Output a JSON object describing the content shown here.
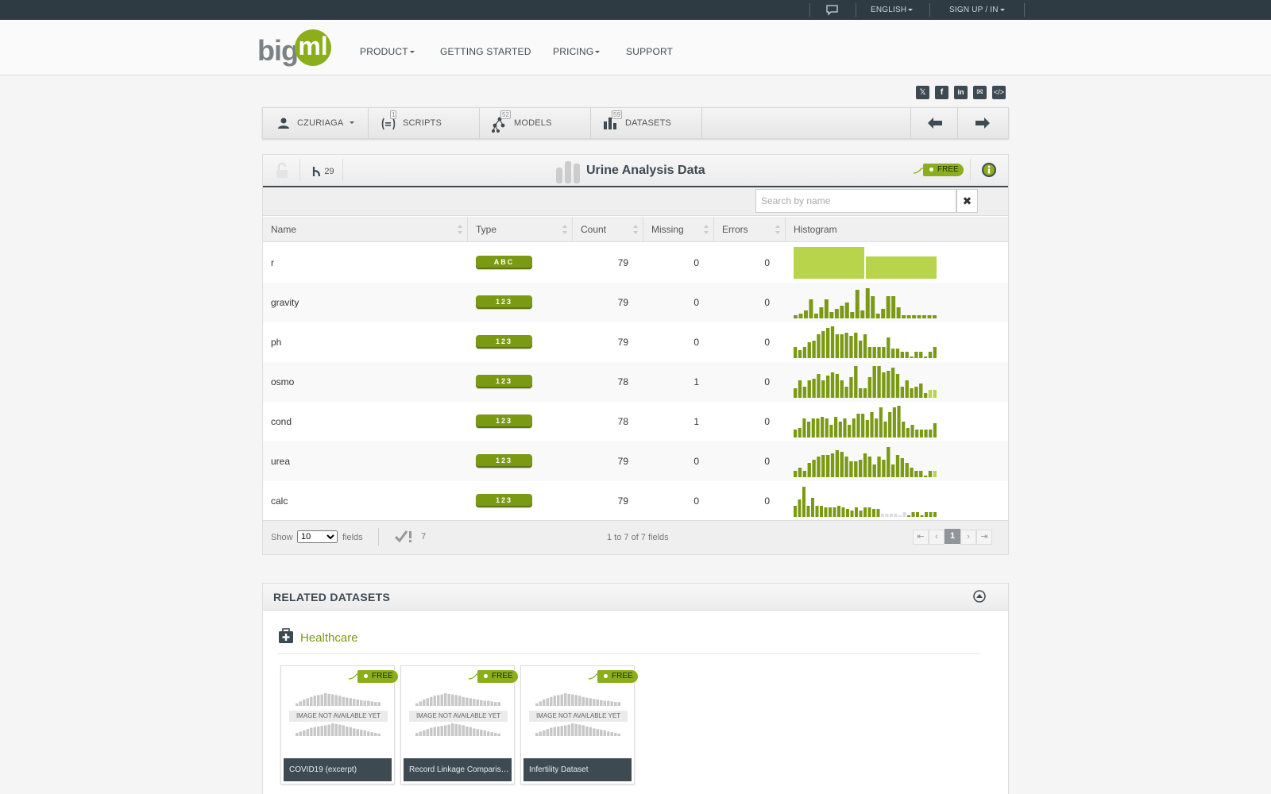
{
  "topbar": {
    "language": "ENGLISH",
    "signin": "SIGN UP / IN"
  },
  "nav": {
    "product": "PRODUCT",
    "getting_started": "GETTING STARTED",
    "pricing": "PRICING",
    "support": "SUPPORT"
  },
  "logo": {
    "left": "big",
    "right": "ml"
  },
  "share_icons": [
    "x-icon",
    "facebook-icon",
    "linkedin-icon",
    "email-icon",
    "embed-icon"
  ],
  "toolbar": {
    "user": "CZURIAGA",
    "scripts": "SCRIPTS",
    "scripts_count": "1",
    "models": "MODELS",
    "models_count": "52",
    "datasets": "DATASETS",
    "datasets_count": "59"
  },
  "dataset": {
    "title": "Urine Analysis Data",
    "forks": "29",
    "price_tag": "FREE",
    "search_placeholder": "Search by name"
  },
  "columns": [
    "Name",
    "Type",
    "Count",
    "Missing",
    "Errors",
    "Histogram"
  ],
  "rows": [
    {
      "name": "r",
      "type": "ABC",
      "count": "79",
      "missing": "0",
      "errors": "0",
      "hist": [
        1.0,
        0.7
      ],
      "hist_kind": "categorical"
    },
    {
      "name": "gravity",
      "type": "123",
      "count": "79",
      "missing": "0",
      "errors": "0",
      "hist": [
        0.1,
        0.15,
        0.25,
        0.6,
        0.15,
        0.35,
        0.6,
        0.2,
        0.3,
        0.4,
        0.5,
        0.2,
        0.9,
        0.25,
        0.95,
        0.7,
        0.15,
        0.3,
        0.7,
        0.7,
        0.35,
        0.1,
        0.1,
        0.1,
        0.1,
        0.1,
        0.1,
        0.1
      ]
    },
    {
      "name": "ph",
      "type": "123",
      "count": "79",
      "missing": "0",
      "errors": "0",
      "hist": [
        0.35,
        0.25,
        0.35,
        0.5,
        0.55,
        0.75,
        0.85,
        0.95,
        1.0,
        0.75,
        0.75,
        0.8,
        0.7,
        0.8,
        0.55,
        0.75,
        0.35,
        0.35,
        0.35,
        0.35,
        0.65,
        0.3,
        0.3,
        0.2,
        0.2,
        0.05,
        0.2,
        0.2,
        0.05,
        0.2,
        0.35
      ]
    },
    {
      "name": "osmo",
      "type": "123",
      "count": "78",
      "missing": "1",
      "errors": "0",
      "hist": [
        0.3,
        0.55,
        0.35,
        0.55,
        0.6,
        0.75,
        0.55,
        0.7,
        0.8,
        0.75,
        0.55,
        0.35,
        0.65,
        1.0,
        0.3,
        0.3,
        0.65,
        1.0,
        1.0,
        0.8,
        0.85,
        0.95,
        0.75,
        0.35,
        0.55,
        0.3,
        0.35,
        0.45,
        0.15,
        0.25,
        0.25
      ],
      "faded_tail": 2
    },
    {
      "name": "cond",
      "type": "123",
      "count": "78",
      "missing": "1",
      "errors": "0",
      "hist": [
        0.25,
        0.3,
        0.6,
        0.5,
        0.6,
        0.6,
        0.65,
        0.6,
        0.4,
        0.65,
        0.5,
        0.6,
        0.4,
        0.6,
        0.75,
        0.75,
        0.55,
        0.8,
        0.6,
        0.95,
        0.5,
        0.8,
        0.95,
        1.0,
        0.5,
        0.3,
        0.4,
        0.25,
        0.25,
        0.25,
        0.25,
        0.45
      ]
    },
    {
      "name": "urea",
      "type": "123",
      "count": "79",
      "missing": "0",
      "errors": "0",
      "hist": [
        0.2,
        0.3,
        0.2,
        0.45,
        0.55,
        0.65,
        0.7,
        0.7,
        0.75,
        0.85,
        0.8,
        0.65,
        0.5,
        0.5,
        0.55,
        0.75,
        0.65,
        0.4,
        0.65,
        0.55,
        0.95,
        0.4,
        0.7,
        0.6,
        0.45,
        0.3,
        0.2,
        0.2,
        0.05,
        0.2,
        0.2
      ],
      "faded_tail": 1
    },
    {
      "name": "calc",
      "type": "123",
      "count": "79",
      "missing": "0",
      "errors": "0",
      "hist": [
        0.35,
        0.55,
        0.95,
        0.35,
        0.6,
        0.35,
        0.35,
        0.3,
        0.3,
        0.3,
        0.35,
        0.3,
        0.25,
        0.2,
        0.3,
        0.2,
        0.3,
        0.3,
        0.25,
        0.25,
        0.1,
        0.1,
        0.1,
        0.1,
        0.05,
        0.15,
        0.05,
        0.15,
        0.15,
        0.05,
        0.15,
        0.15,
        0.15
      ],
      "faded_range": [
        20,
        25
      ]
    }
  ],
  "footer": {
    "show": "Show",
    "fields": "fields",
    "page_size": "10",
    "warnings": "7",
    "range": "1 to 7 of 7 fields",
    "page": "1"
  },
  "related": {
    "title": "RELATED DATASETS",
    "category": "Healthcare",
    "na": "IMAGE NOT AVAILABLE YET",
    "cards": [
      {
        "name": "COVID19 (excerpt)",
        "tag": "FREE"
      },
      {
        "name": "Record Linkage Comparis…",
        "tag": "FREE"
      },
      {
        "name": "Infertility Dataset",
        "tag": "FREE"
      }
    ]
  },
  "colors": {
    "accent": "#8cae1c",
    "bar": "#7b9a14",
    "bar_light": "#b7d44a",
    "dark": "#2e3b42"
  }
}
